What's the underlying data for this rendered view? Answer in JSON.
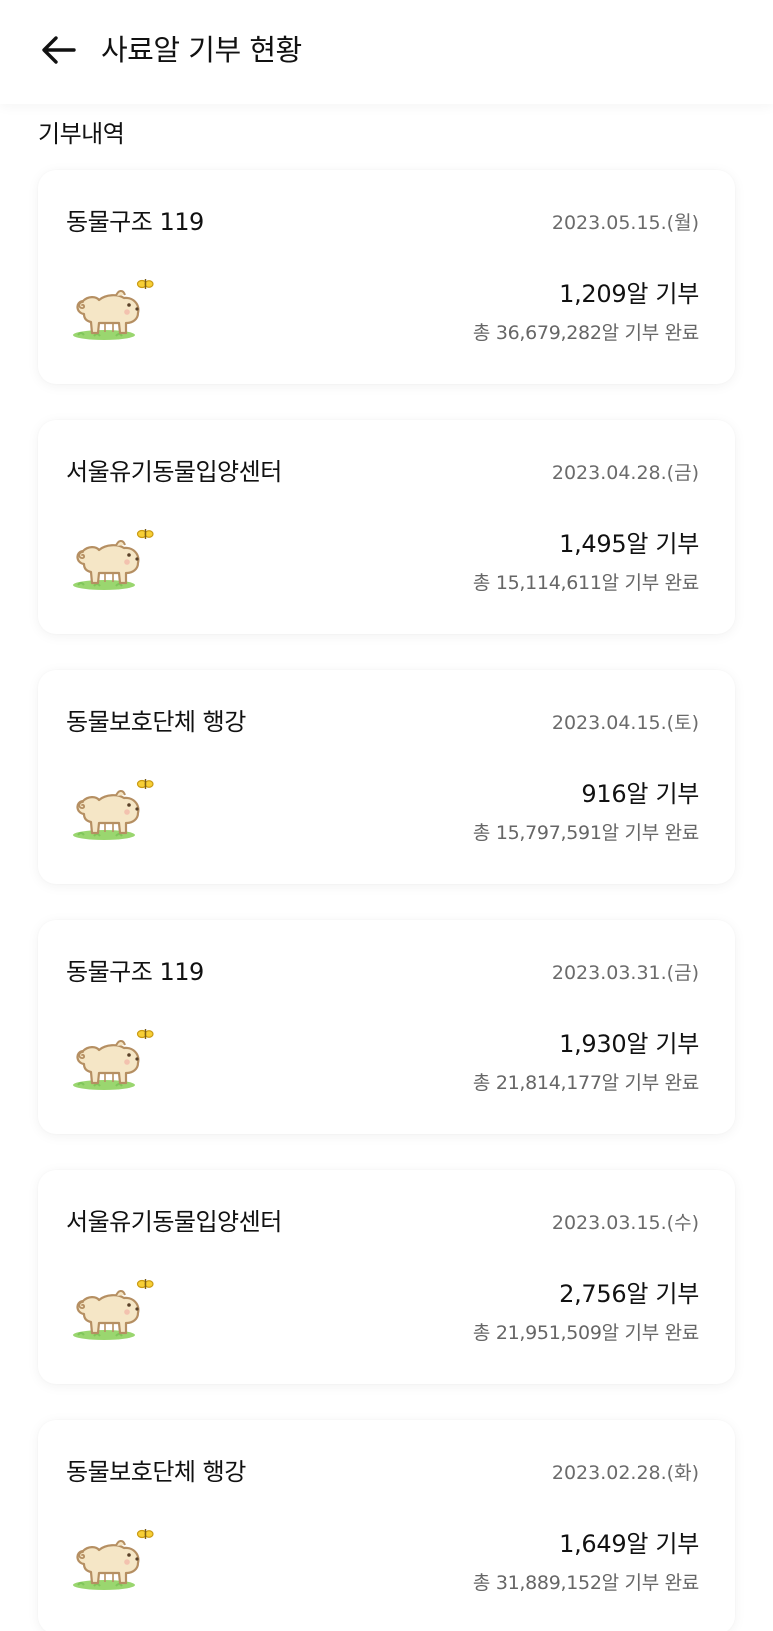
{
  "header": {
    "back_icon": "arrow-left-icon",
    "title": "사료알 기부 현황"
  },
  "section": {
    "label": "기부내역"
  },
  "donations": [
    {
      "org": "동물구조 119",
      "date": "2023.05.15.(월)",
      "amount": "1,209알 기부",
      "total": "총 36,679,282알 기부 완료"
    },
    {
      "org": "서울유기동물입양센터",
      "date": "2023.04.28.(금)",
      "amount": "1,495알 기부",
      "total": "총 15,114,611알 기부 완료"
    },
    {
      "org": "동물보호단체 행강",
      "date": "2023.04.15.(토)",
      "amount": "916알 기부",
      "total": "총 15,797,591알 기부 완료"
    },
    {
      "org": "동물구조 119",
      "date": "2023.03.31.(금)",
      "amount": "1,930알 기부",
      "total": "총 21,814,177알 기부 완료"
    },
    {
      "org": "서울유기동물입양센터",
      "date": "2023.03.15.(수)",
      "amount": "2,756알 기부",
      "total": "총 21,951,509알 기부 완료"
    },
    {
      "org": "동물보호단체 행강",
      "date": "2023.02.28.(화)",
      "amount": "1,649알 기부",
      "total": "총 31,889,152알 기부 완료"
    }
  ],
  "colors": {
    "text_primary": "#111111",
    "text_secondary": "#666666",
    "dog_fill": "#f5e6c6",
    "dog_outline": "#b58f62",
    "grass": "#8fd36a",
    "butterfly": "#f7cf35"
  },
  "illustration_icon": "puppy-with-butterfly-icon"
}
